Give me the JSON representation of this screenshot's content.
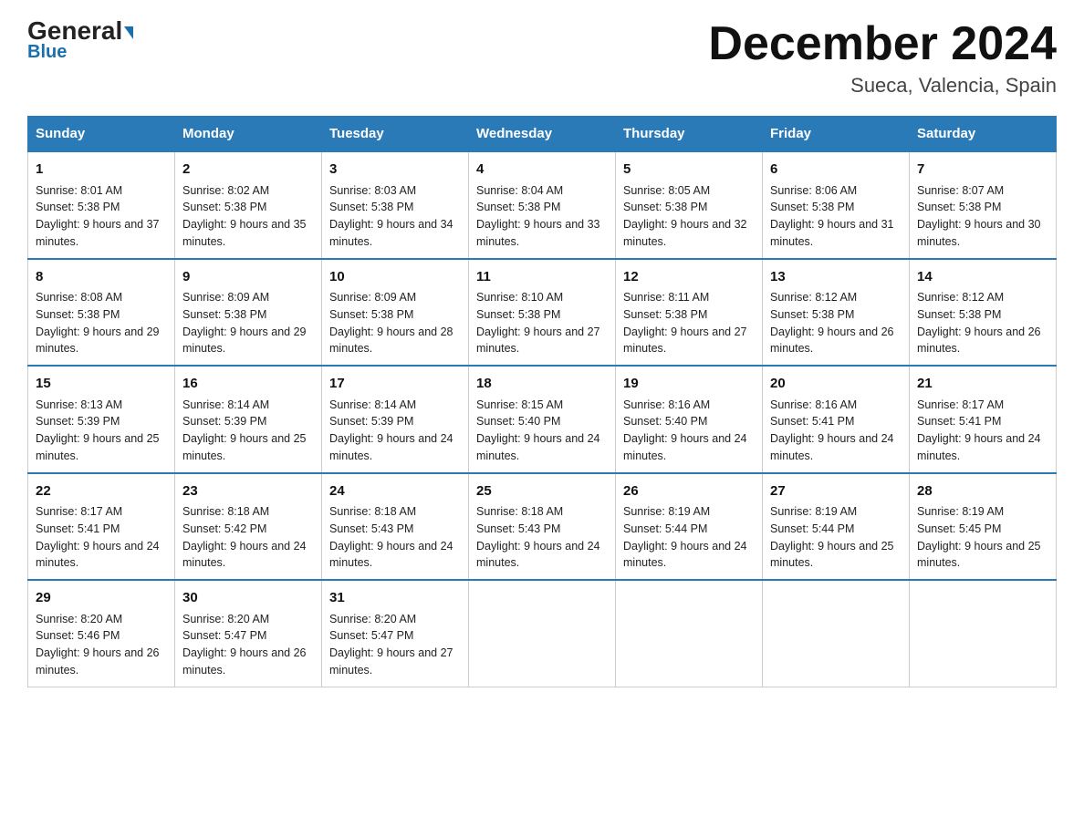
{
  "header": {
    "logo_general": "General",
    "logo_blue": "Blue",
    "title": "December 2024",
    "subtitle": "Sueca, Valencia, Spain"
  },
  "days_of_week": [
    "Sunday",
    "Monday",
    "Tuesday",
    "Wednesday",
    "Thursday",
    "Friday",
    "Saturday"
  ],
  "weeks": [
    [
      {
        "day": "1",
        "sunrise": "8:01 AM",
        "sunset": "5:38 PM",
        "daylight": "9 hours and 37 minutes."
      },
      {
        "day": "2",
        "sunrise": "8:02 AM",
        "sunset": "5:38 PM",
        "daylight": "9 hours and 35 minutes."
      },
      {
        "day": "3",
        "sunrise": "8:03 AM",
        "sunset": "5:38 PM",
        "daylight": "9 hours and 34 minutes."
      },
      {
        "day": "4",
        "sunrise": "8:04 AM",
        "sunset": "5:38 PM",
        "daylight": "9 hours and 33 minutes."
      },
      {
        "day": "5",
        "sunrise": "8:05 AM",
        "sunset": "5:38 PM",
        "daylight": "9 hours and 32 minutes."
      },
      {
        "day": "6",
        "sunrise": "8:06 AM",
        "sunset": "5:38 PM",
        "daylight": "9 hours and 31 minutes."
      },
      {
        "day": "7",
        "sunrise": "8:07 AM",
        "sunset": "5:38 PM",
        "daylight": "9 hours and 30 minutes."
      }
    ],
    [
      {
        "day": "8",
        "sunrise": "8:08 AM",
        "sunset": "5:38 PM",
        "daylight": "9 hours and 29 minutes."
      },
      {
        "day": "9",
        "sunrise": "8:09 AM",
        "sunset": "5:38 PM",
        "daylight": "9 hours and 29 minutes."
      },
      {
        "day": "10",
        "sunrise": "8:09 AM",
        "sunset": "5:38 PM",
        "daylight": "9 hours and 28 minutes."
      },
      {
        "day": "11",
        "sunrise": "8:10 AM",
        "sunset": "5:38 PM",
        "daylight": "9 hours and 27 minutes."
      },
      {
        "day": "12",
        "sunrise": "8:11 AM",
        "sunset": "5:38 PM",
        "daylight": "9 hours and 27 minutes."
      },
      {
        "day": "13",
        "sunrise": "8:12 AM",
        "sunset": "5:38 PM",
        "daylight": "9 hours and 26 minutes."
      },
      {
        "day": "14",
        "sunrise": "8:12 AM",
        "sunset": "5:38 PM",
        "daylight": "9 hours and 26 minutes."
      }
    ],
    [
      {
        "day": "15",
        "sunrise": "8:13 AM",
        "sunset": "5:39 PM",
        "daylight": "9 hours and 25 minutes."
      },
      {
        "day": "16",
        "sunrise": "8:14 AM",
        "sunset": "5:39 PM",
        "daylight": "9 hours and 25 minutes."
      },
      {
        "day": "17",
        "sunrise": "8:14 AM",
        "sunset": "5:39 PM",
        "daylight": "9 hours and 24 minutes."
      },
      {
        "day": "18",
        "sunrise": "8:15 AM",
        "sunset": "5:40 PM",
        "daylight": "9 hours and 24 minutes."
      },
      {
        "day": "19",
        "sunrise": "8:16 AM",
        "sunset": "5:40 PM",
        "daylight": "9 hours and 24 minutes."
      },
      {
        "day": "20",
        "sunrise": "8:16 AM",
        "sunset": "5:41 PM",
        "daylight": "9 hours and 24 minutes."
      },
      {
        "day": "21",
        "sunrise": "8:17 AM",
        "sunset": "5:41 PM",
        "daylight": "9 hours and 24 minutes."
      }
    ],
    [
      {
        "day": "22",
        "sunrise": "8:17 AM",
        "sunset": "5:41 PM",
        "daylight": "9 hours and 24 minutes."
      },
      {
        "day": "23",
        "sunrise": "8:18 AM",
        "sunset": "5:42 PM",
        "daylight": "9 hours and 24 minutes."
      },
      {
        "day": "24",
        "sunrise": "8:18 AM",
        "sunset": "5:43 PM",
        "daylight": "9 hours and 24 minutes."
      },
      {
        "day": "25",
        "sunrise": "8:18 AM",
        "sunset": "5:43 PM",
        "daylight": "9 hours and 24 minutes."
      },
      {
        "day": "26",
        "sunrise": "8:19 AM",
        "sunset": "5:44 PM",
        "daylight": "9 hours and 24 minutes."
      },
      {
        "day": "27",
        "sunrise": "8:19 AM",
        "sunset": "5:44 PM",
        "daylight": "9 hours and 25 minutes."
      },
      {
        "day": "28",
        "sunrise": "8:19 AM",
        "sunset": "5:45 PM",
        "daylight": "9 hours and 25 minutes."
      }
    ],
    [
      {
        "day": "29",
        "sunrise": "8:20 AM",
        "sunset": "5:46 PM",
        "daylight": "9 hours and 26 minutes."
      },
      {
        "day": "30",
        "sunrise": "8:20 AM",
        "sunset": "5:47 PM",
        "daylight": "9 hours and 26 minutes."
      },
      {
        "day": "31",
        "sunrise": "8:20 AM",
        "sunset": "5:47 PM",
        "daylight": "9 hours and 27 minutes."
      },
      null,
      null,
      null,
      null
    ]
  ],
  "labels": {
    "sunrise": "Sunrise: ",
    "sunset": "Sunset: ",
    "daylight": "Daylight: "
  }
}
